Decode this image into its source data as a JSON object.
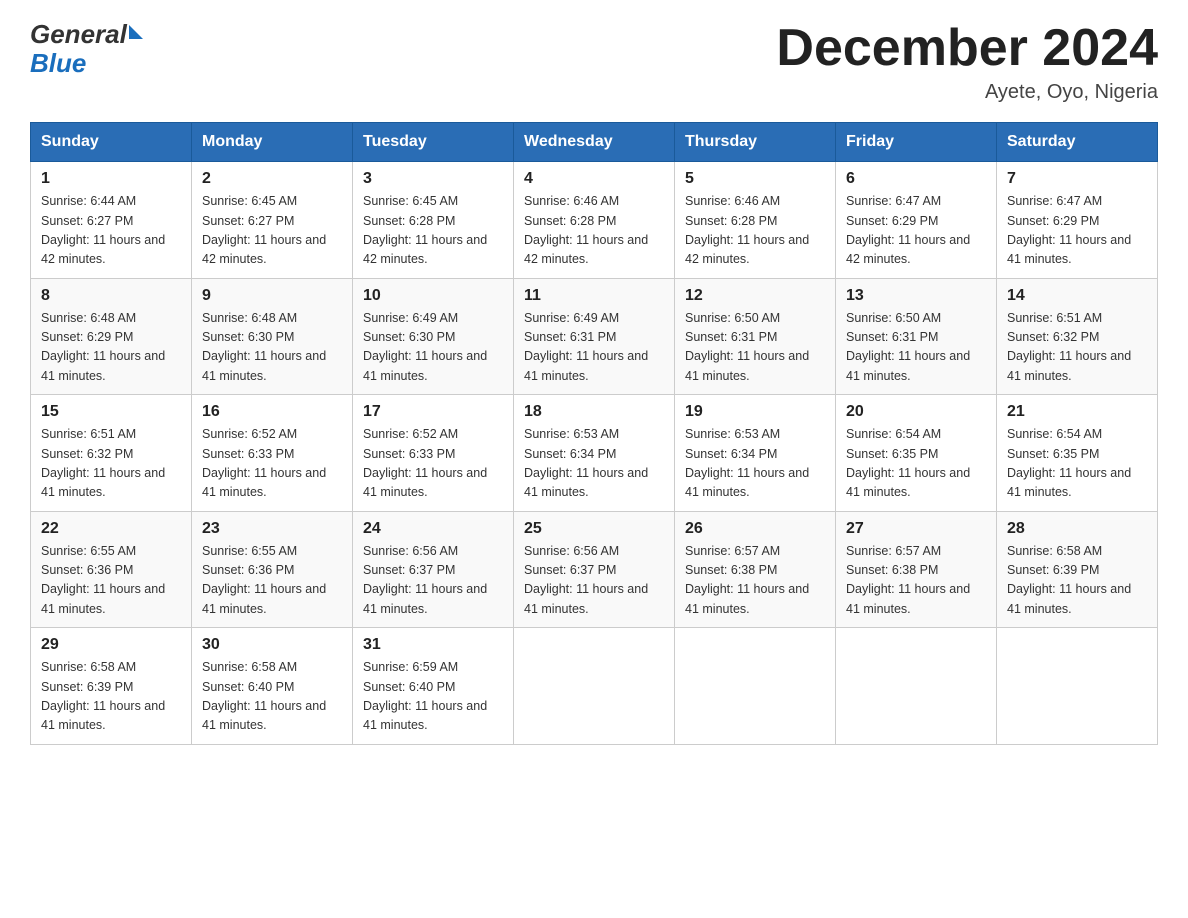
{
  "header": {
    "logo_general": "General",
    "logo_blue": "Blue",
    "month_title": "December 2024",
    "location": "Ayete, Oyo, Nigeria"
  },
  "days_of_week": [
    "Sunday",
    "Monday",
    "Tuesday",
    "Wednesday",
    "Thursday",
    "Friday",
    "Saturday"
  ],
  "weeks": [
    [
      {
        "day": "1",
        "sunrise": "6:44 AM",
        "sunset": "6:27 PM",
        "daylight": "11 hours and 42 minutes."
      },
      {
        "day": "2",
        "sunrise": "6:45 AM",
        "sunset": "6:27 PM",
        "daylight": "11 hours and 42 minutes."
      },
      {
        "day": "3",
        "sunrise": "6:45 AM",
        "sunset": "6:28 PM",
        "daylight": "11 hours and 42 minutes."
      },
      {
        "day": "4",
        "sunrise": "6:46 AM",
        "sunset": "6:28 PM",
        "daylight": "11 hours and 42 minutes."
      },
      {
        "day": "5",
        "sunrise": "6:46 AM",
        "sunset": "6:28 PM",
        "daylight": "11 hours and 42 minutes."
      },
      {
        "day": "6",
        "sunrise": "6:47 AM",
        "sunset": "6:29 PM",
        "daylight": "11 hours and 42 minutes."
      },
      {
        "day": "7",
        "sunrise": "6:47 AM",
        "sunset": "6:29 PM",
        "daylight": "11 hours and 41 minutes."
      }
    ],
    [
      {
        "day": "8",
        "sunrise": "6:48 AM",
        "sunset": "6:29 PM",
        "daylight": "11 hours and 41 minutes."
      },
      {
        "day": "9",
        "sunrise": "6:48 AM",
        "sunset": "6:30 PM",
        "daylight": "11 hours and 41 minutes."
      },
      {
        "day": "10",
        "sunrise": "6:49 AM",
        "sunset": "6:30 PM",
        "daylight": "11 hours and 41 minutes."
      },
      {
        "day": "11",
        "sunrise": "6:49 AM",
        "sunset": "6:31 PM",
        "daylight": "11 hours and 41 minutes."
      },
      {
        "day": "12",
        "sunrise": "6:50 AM",
        "sunset": "6:31 PM",
        "daylight": "11 hours and 41 minutes."
      },
      {
        "day": "13",
        "sunrise": "6:50 AM",
        "sunset": "6:31 PM",
        "daylight": "11 hours and 41 minutes."
      },
      {
        "day": "14",
        "sunrise": "6:51 AM",
        "sunset": "6:32 PM",
        "daylight": "11 hours and 41 minutes."
      }
    ],
    [
      {
        "day": "15",
        "sunrise": "6:51 AM",
        "sunset": "6:32 PM",
        "daylight": "11 hours and 41 minutes."
      },
      {
        "day": "16",
        "sunrise": "6:52 AM",
        "sunset": "6:33 PM",
        "daylight": "11 hours and 41 minutes."
      },
      {
        "day": "17",
        "sunrise": "6:52 AM",
        "sunset": "6:33 PM",
        "daylight": "11 hours and 41 minutes."
      },
      {
        "day": "18",
        "sunrise": "6:53 AM",
        "sunset": "6:34 PM",
        "daylight": "11 hours and 41 minutes."
      },
      {
        "day": "19",
        "sunrise": "6:53 AM",
        "sunset": "6:34 PM",
        "daylight": "11 hours and 41 minutes."
      },
      {
        "day": "20",
        "sunrise": "6:54 AM",
        "sunset": "6:35 PM",
        "daylight": "11 hours and 41 minutes."
      },
      {
        "day": "21",
        "sunrise": "6:54 AM",
        "sunset": "6:35 PM",
        "daylight": "11 hours and 41 minutes."
      }
    ],
    [
      {
        "day": "22",
        "sunrise": "6:55 AM",
        "sunset": "6:36 PM",
        "daylight": "11 hours and 41 minutes."
      },
      {
        "day": "23",
        "sunrise": "6:55 AM",
        "sunset": "6:36 PM",
        "daylight": "11 hours and 41 minutes."
      },
      {
        "day": "24",
        "sunrise": "6:56 AM",
        "sunset": "6:37 PM",
        "daylight": "11 hours and 41 minutes."
      },
      {
        "day": "25",
        "sunrise": "6:56 AM",
        "sunset": "6:37 PM",
        "daylight": "11 hours and 41 minutes."
      },
      {
        "day": "26",
        "sunrise": "6:57 AM",
        "sunset": "6:38 PM",
        "daylight": "11 hours and 41 minutes."
      },
      {
        "day": "27",
        "sunrise": "6:57 AM",
        "sunset": "6:38 PM",
        "daylight": "11 hours and 41 minutes."
      },
      {
        "day": "28",
        "sunrise": "6:58 AM",
        "sunset": "6:39 PM",
        "daylight": "11 hours and 41 minutes."
      }
    ],
    [
      {
        "day": "29",
        "sunrise": "6:58 AM",
        "sunset": "6:39 PM",
        "daylight": "11 hours and 41 minutes."
      },
      {
        "day": "30",
        "sunrise": "6:58 AM",
        "sunset": "6:40 PM",
        "daylight": "11 hours and 41 minutes."
      },
      {
        "day": "31",
        "sunrise": "6:59 AM",
        "sunset": "6:40 PM",
        "daylight": "11 hours and 41 minutes."
      },
      null,
      null,
      null,
      null
    ]
  ]
}
